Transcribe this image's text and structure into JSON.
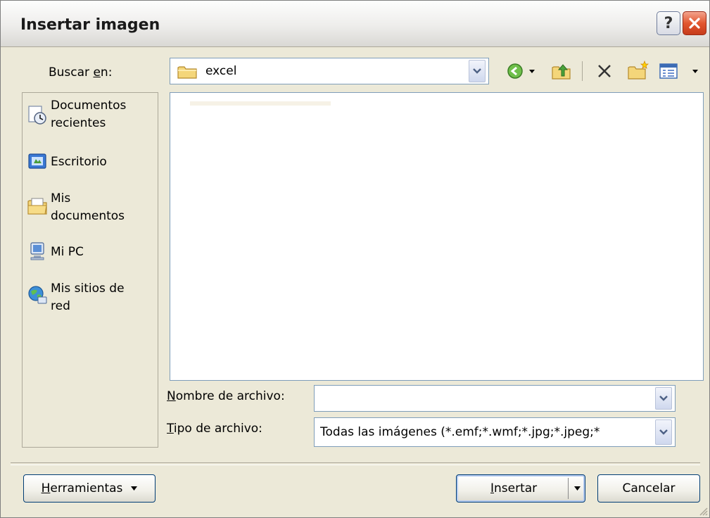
{
  "window": {
    "title": "Insertar imagen",
    "help_label": "?"
  },
  "lookin": {
    "label_pre": "Buscar ",
    "label_accel": "e",
    "label_post": "n:",
    "value": "excel"
  },
  "toolbar": {
    "icons": [
      "back-icon",
      "up-folder-icon",
      "delete-icon",
      "new-folder-icon",
      "views-icon"
    ]
  },
  "places": [
    {
      "name": "places-recent",
      "icon": "recent-documents-icon",
      "label1": "Documentos",
      "label2": "recientes"
    },
    {
      "name": "places-desktop",
      "icon": "desktop-icon",
      "label1": "Escritorio",
      "label2": ""
    },
    {
      "name": "places-my-documents",
      "icon": "my-documents-icon",
      "label1": "Mis",
      "label2": "documentos"
    },
    {
      "name": "places-my-computer",
      "icon": "my-computer-icon",
      "label1": "Mi PC",
      "label2": ""
    },
    {
      "name": "places-network",
      "icon": "network-places-icon",
      "label1": "Mis sitios de",
      "label2": "red"
    }
  ],
  "filename": {
    "label_accel": "N",
    "label_rest": "ombre de archivo:",
    "value": ""
  },
  "filetype": {
    "label_accel": "T",
    "label_rest": "ipo de archivo:",
    "value": "Todas las imágenes (*.emf;*.wmf;*.jpg;*.jpeg;*"
  },
  "buttons": {
    "tools_accel": "H",
    "tools_rest": "erramientas",
    "insert_accel": "I",
    "insert_rest": "nsertar",
    "cancel": "Cancelar"
  },
  "colors": {
    "dialog_bg": "#ece9d8",
    "field_border": "#7f9db9",
    "close_red": "#e2572f"
  }
}
